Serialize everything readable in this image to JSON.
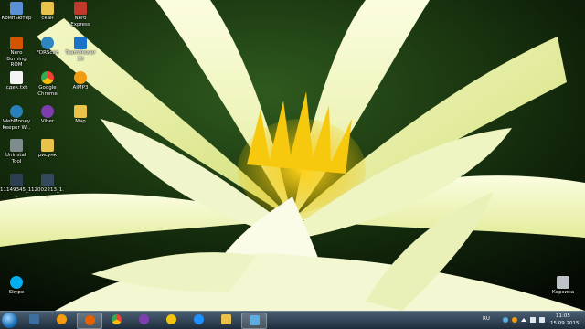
{
  "desktop": {
    "icons": [
      {
        "label": "Компьютер",
        "color": "#5b8fd6"
      },
      {
        "label": "скан",
        "color": "#e8c24a"
      },
      {
        "label": "Nero Express",
        "color": "#c0392b"
      },
      {
        "label": "Nero Burning ROM",
        "color": "#d35400"
      },
      {
        "label": "FDRScan",
        "color": "#2e86c1"
      },
      {
        "label": "TeamViewer 10",
        "color": "#1a73c7"
      },
      {
        "label": "сдек.txt",
        "color": "#f4f4f4"
      },
      {
        "label": "Google Chrome",
        "color": "#34a853"
      },
      {
        "label": "AIMP3",
        "color": "#f39c12"
      },
      {
        "label": "WebMoney Keeper W...",
        "color": "#2980b9"
      },
      {
        "label": "Viber",
        "color": "#7d3daf"
      },
      {
        "label": "Map",
        "color": "#e8c24a"
      },
      {
        "label": "Uninstall Tool",
        "color": "#7f8c8d"
      },
      {
        "label": "рисунк",
        "color": "#e8c24a"
      },
      {
        "label": "11149345_1...",
        "color": "#2c3e50"
      },
      {
        "label": "12002213_1...",
        "color": "#34495e"
      },
      {
        "label": "Skype",
        "color": "#00aff0"
      },
      {
        "label": "Корзина",
        "color": "#bdc3c7"
      }
    ]
  },
  "taskbar": {
    "start_label": "Пуск",
    "pinned": [
      {
        "name": "explorer",
        "color": "#3d6f9e"
      },
      {
        "name": "aimp",
        "color": "#f39c12"
      },
      {
        "name": "firefox",
        "color": "#e66000"
      },
      {
        "name": "chrome",
        "color": "#34a853"
      },
      {
        "name": "viber",
        "color": "#7d3daf"
      },
      {
        "name": "messenger",
        "color": "#f1c40f"
      },
      {
        "name": "internet-explorer",
        "color": "#1e90ff"
      },
      {
        "name": "folder",
        "color": "#e8c24a"
      },
      {
        "name": "remote-desktop",
        "color": "#5dade2"
      }
    ],
    "tray": {
      "language": "RU",
      "time": "11:05",
      "date": "15.09.2015"
    }
  }
}
